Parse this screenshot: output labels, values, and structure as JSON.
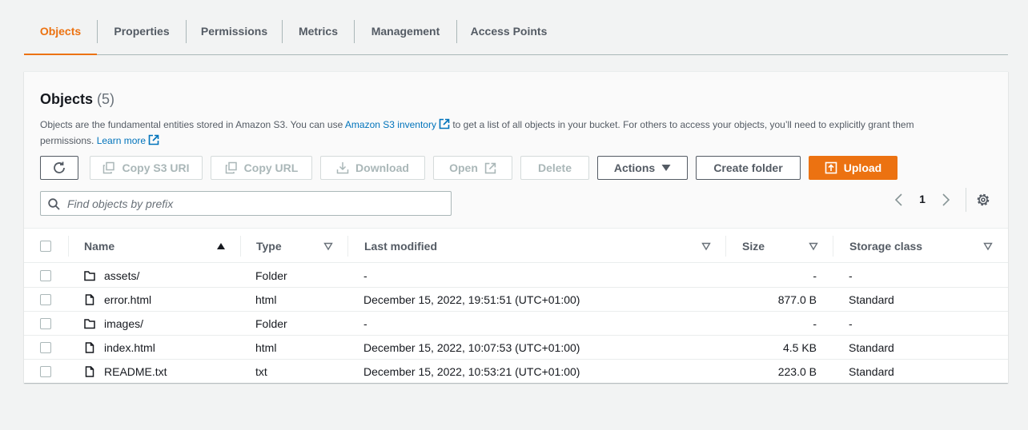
{
  "tabs": [
    {
      "label": "Objects",
      "active": true
    },
    {
      "label": "Properties"
    },
    {
      "label": "Permissions"
    },
    {
      "label": "Metrics"
    },
    {
      "label": "Management"
    },
    {
      "label": "Access Points"
    }
  ],
  "objects": {
    "title": "Objects",
    "count": "(5)",
    "description_part1": "Objects are the fundamental entities stored in Amazon S3. You can use ",
    "inventory_link": "Amazon S3 inventory",
    "description_part2": " to get a list of all objects in your bucket. For others to access your objects, you’ll need to explicitly grant them permissions.",
    "learn_more": "Learn more"
  },
  "toolbar": {
    "copy_s3_uri": "Copy S3 URI",
    "copy_url": "Copy URL",
    "download": "Download",
    "open": "Open",
    "delete": "Delete",
    "actions": "Actions",
    "create_folder": "Create folder",
    "upload": "Upload"
  },
  "search": {
    "placeholder": "Find objects by prefix",
    "value": ""
  },
  "pagination": {
    "current_page": "1"
  },
  "table": {
    "columns": {
      "name": "Name",
      "type": "Type",
      "last_modified": "Last modified",
      "size": "Size",
      "storage_class": "Storage class"
    },
    "rows": [
      {
        "name": "assets/",
        "icon": "folder-icon",
        "type": "Folder",
        "last_modified": "-",
        "size": "-",
        "storage_class": "-"
      },
      {
        "name": "error.html",
        "icon": "file-icon",
        "type": "html",
        "last_modified": "December 15, 2022, 19:51:51 (UTC+01:00)",
        "size": "877.0 B",
        "storage_class": "Standard"
      },
      {
        "name": "images/",
        "icon": "folder-icon",
        "type": "Folder",
        "last_modified": "-",
        "size": "-",
        "storage_class": "-"
      },
      {
        "name": "index.html",
        "icon": "file-icon",
        "type": "html",
        "last_modified": "December 15, 2022, 10:07:53 (UTC+01:00)",
        "size": "4.5 KB",
        "storage_class": "Standard"
      },
      {
        "name": "README.txt",
        "icon": "file-icon",
        "type": "txt",
        "last_modified": "December 15, 2022, 10:53:21 (UTC+01:00)",
        "size": "223.0 B",
        "storage_class": "Standard"
      }
    ]
  },
  "colors": {
    "accent": "#ec7211",
    "link": "#0073bb",
    "text": "#16191f",
    "muted": "#545b64"
  }
}
